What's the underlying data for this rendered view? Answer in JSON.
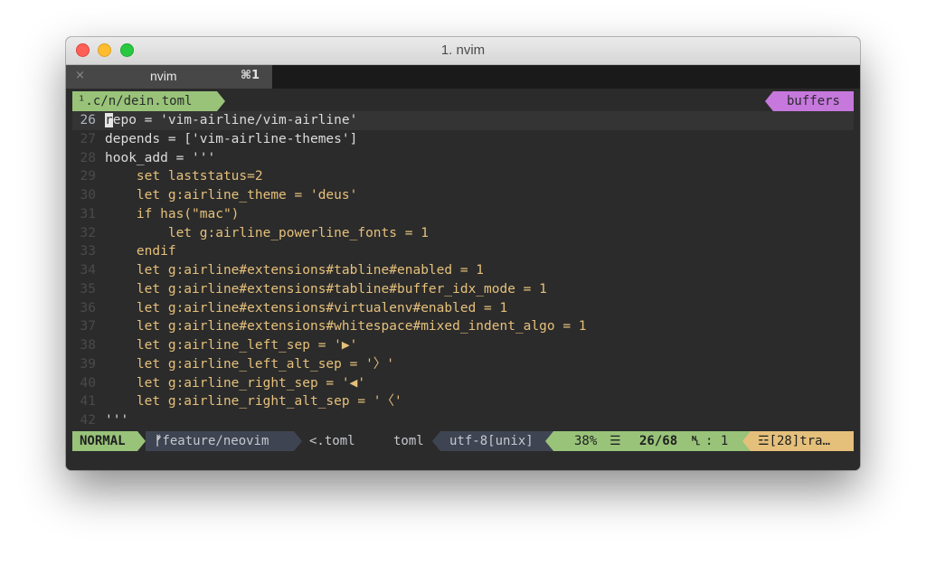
{
  "window": {
    "title": "1. nvim"
  },
  "tab": {
    "close_icon": "×",
    "label": "nvim",
    "shortcut": "⌘1"
  },
  "tabline": {
    "buffer": "¹.c/n/dein.toml",
    "buffers_label": "buffers"
  },
  "editor": {
    "cursor_char": "r",
    "lines": [
      {
        "num": "26",
        "text": "epo = 'vim-airline/vim-airline'"
      },
      {
        "num": "27",
        "text": "depends = ['vim-airline-themes']"
      },
      {
        "num": "28",
        "text": "hook_add = '''"
      },
      {
        "num": "29",
        "text": "    set laststatus=2"
      },
      {
        "num": "30",
        "text": "    let g:airline_theme = 'deus'"
      },
      {
        "num": "31",
        "text": "    if has(\"mac\")"
      },
      {
        "num": "32",
        "text": "        let g:airline_powerline_fonts = 1"
      },
      {
        "num": "33",
        "text": "    endif"
      },
      {
        "num": "34",
        "text": "    let g:airline#extensions#tabline#enabled = 1"
      },
      {
        "num": "35",
        "text": "    let g:airline#extensions#tabline#buffer_idx_mode = 1"
      },
      {
        "num": "36",
        "text": "    let g:airline#extensions#virtualenv#enabled = 1"
      },
      {
        "num": "37",
        "text": "    let g:airline#extensions#whitespace#mixed_indent_algo = 1"
      },
      {
        "num": "38",
        "text": "    let g:airline_left_sep = '▶'"
      },
      {
        "num": "39",
        "text": "    let g:airline_left_alt_sep = '〉'"
      },
      {
        "num": "40",
        "text": "    let g:airline_right_sep = '◀'"
      },
      {
        "num": "41",
        "text": "    let g:airline_right_alt_sep = '〈'"
      },
      {
        "num": "42",
        "text": "'''"
      }
    ]
  },
  "statusline": {
    "mode": "NORMAL",
    "branch_icon": "ᚠ",
    "branch": "feature/neovim",
    "filename": "<.toml",
    "filetype": "toml",
    "encoding": "utf-8[unix]",
    "percent": "38%",
    "percent_icon": "☰",
    "position": "26/68",
    "ln_icon": "␤",
    "column": ":  1",
    "warning_icon": "☲",
    "warning": "[28]tra…"
  },
  "colors": {
    "mode_bg": "#98c379",
    "branch_bg": "#3e4452",
    "buffers_bg": "#c678dd",
    "warning_bg": "#e5c07b",
    "code_fg": "#e5c07b"
  }
}
